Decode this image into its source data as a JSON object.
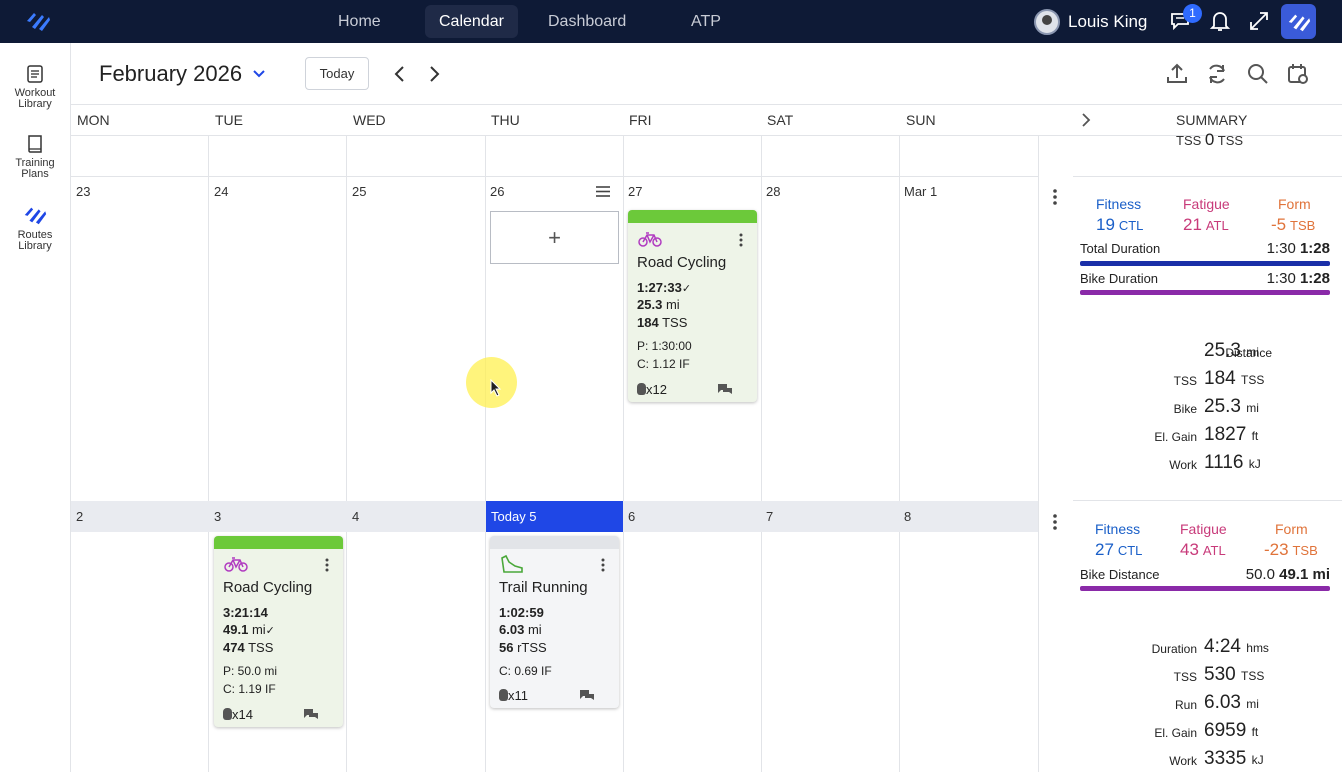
{
  "nav": {
    "items": [
      {
        "label": "Home"
      },
      {
        "label": "Calendar"
      },
      {
        "label": "Dashboard"
      },
      {
        "label": "ATP"
      }
    ],
    "active": "Calendar",
    "user_name": "Louis King",
    "notification_count": "1"
  },
  "sidebar": {
    "items": [
      {
        "label_line1": "Workout",
        "label_line2": "Library"
      },
      {
        "label_line1": "Training",
        "label_line2": "Plans"
      },
      {
        "label_line1": "Routes",
        "label_line2": "Library"
      }
    ]
  },
  "header": {
    "month": "February 2026",
    "today_label": "Today"
  },
  "days": [
    "MON",
    "TUE",
    "WED",
    "THU",
    "FRI",
    "SAT",
    "SUN"
  ],
  "summary_label": "SUMMARY",
  "prev_week_tss": {
    "label": "TSS",
    "value": "0",
    "unit": "TSS"
  },
  "week1": {
    "dates": [
      "23",
      "24",
      "25",
      "26",
      "27",
      "28",
      "Mar 1"
    ],
    "card": {
      "title": "Road Cycling",
      "duration": "1:27:33",
      "check": "✓",
      "distance": "25.3",
      "distance_unit": "mi",
      "tss": "184",
      "tss_unit": "TSS",
      "planned": "P: 1:30:00",
      "compliance": "C: 1.12 IF",
      "kudos": "x12"
    },
    "summary": {
      "fitness_label": "Fitness",
      "fitness_value": "19",
      "fitness_unit": "CTL",
      "fatigue_label": "Fatigue",
      "fatigue_value": "21",
      "fatigue_unit": "ATL",
      "form_label": "Form",
      "form_value": "-5",
      "form_unit": "TSB",
      "bars": [
        {
          "label": "Total Duration",
          "planned": "1:30",
          "actual": "1:28",
          "color": "#1a2fa8"
        },
        {
          "label": "Bike Duration",
          "planned": "1:30",
          "actual": "1:28",
          "color": "#8a2aa8"
        }
      ],
      "stats": [
        {
          "label": "Distance",
          "value": "25.3",
          "unit": "mi"
        },
        {
          "label": "TSS",
          "value": "184",
          "unit": "TSS"
        },
        {
          "label": "Bike",
          "value": "25.3",
          "unit": "mi"
        },
        {
          "label": "El. Gain",
          "value": "1827",
          "unit": "ft"
        },
        {
          "label": "Work",
          "value": "1116",
          "unit": "kJ"
        }
      ]
    }
  },
  "week2": {
    "dates": [
      "2",
      "3",
      "4",
      "Today 5",
      "6",
      "7",
      "8"
    ],
    "card_cycling": {
      "title": "Road Cycling",
      "duration": "3:21:14",
      "distance": "49.1",
      "distance_unit": "mi",
      "check": "✓",
      "tss": "474",
      "tss_unit": "TSS",
      "planned": "P: 50.0 mi",
      "compliance": "C: 1.19 IF",
      "kudos": "x14"
    },
    "card_running": {
      "title": "Trail Running",
      "duration": "1:02:59",
      "distance": "6.03",
      "distance_unit": "mi",
      "tss": "56",
      "tss_unit": "rTSS",
      "compliance": "C: 0.69 IF",
      "kudos": "x11"
    },
    "summary": {
      "fitness_label": "Fitness",
      "fitness_value": "27",
      "fitness_unit": "CTL",
      "fatigue_label": "Fatigue",
      "fatigue_value": "43",
      "fatigue_unit": "ATL",
      "form_label": "Form",
      "form_value": "-23",
      "form_unit": "TSB",
      "bars": [
        {
          "label": "Bike Distance",
          "planned": "50.0",
          "actual": "49.1 mi",
          "color": "#8a2aa8"
        }
      ],
      "stats": [
        {
          "label": "Duration",
          "value": "4:24",
          "unit": "hms"
        },
        {
          "label": "TSS",
          "value": "530",
          "unit": "TSS"
        },
        {
          "label": "Run",
          "value": "6.03",
          "unit": "mi"
        },
        {
          "label": "El. Gain",
          "value": "6959",
          "unit": "ft"
        },
        {
          "label": "Work",
          "value": "3335",
          "unit": "kJ"
        }
      ]
    }
  },
  "colors": {
    "topbar": "#0e1a36",
    "accent": "#1f47e6",
    "fitness": "#1a5fc8",
    "fatigue": "#c83a7a",
    "form": "#e0733a",
    "workout_complete": "#6cc93a"
  }
}
